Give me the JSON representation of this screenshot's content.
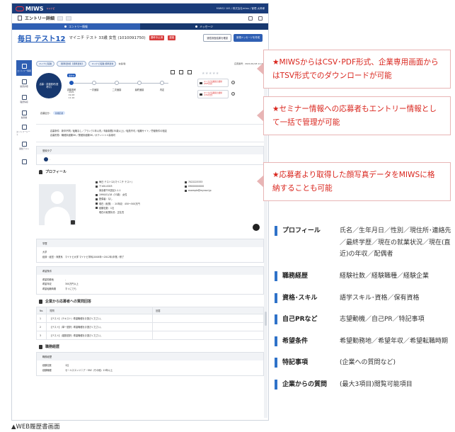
{
  "app": {
    "logo_text": "MIWS",
    "logo_sub": "マイナビ",
    "header_right": "MIWS2 10S / 株式会社miws / 管理 太郎様"
  },
  "titlebar": {
    "title": "エントリー詳細"
  },
  "tabs": [
    {
      "label": "エントリー情報",
      "active": true
    },
    {
      "label": "メッセージ",
      "active": false
    }
  ],
  "candidate": {
    "name": "毎日 テスト12",
    "kana_line": "マイニチ テスト 33歳 女性 (1010091750)",
    "badge1": "選考中止済",
    "badge2": "重複",
    "btn_assess": "適性検査結果を確認",
    "btn_message": "新規メッセージを作成"
  },
  "sidebar": [
    {
      "label": "エントリー情報",
      "active": true,
      "icon": "person-icon"
    },
    {
      "label": "履歴詳細",
      "active": false,
      "icon": "edit-icon"
    },
    {
      "label": "職歴情報",
      "active": false,
      "icon": "list-icon"
    },
    {
      "label": "履歴書",
      "active": false,
      "icon": "doc-icon"
    },
    {
      "label": "エントリーシート",
      "active": false,
      "icon": "person-icon"
    },
    {
      "label": "適性テスト",
      "active": false,
      "icon": "doc-icon"
    },
    {
      "label": "",
      "active": false,
      "icon": "share-icon"
    }
  ],
  "status": {
    "chip1": "マイナビ転職",
    "chip2": "【標準選考】【標準選考】",
    "chip3": "マイナビ転職 標準選考",
    "chip_label": "言語/職",
    "app_no": "応募番号：2021/01/18 11:47"
  },
  "progress": {
    "circle_text": "応募・書類選考(選考中)",
    "now_tag": "選考中",
    "steps": [
      {
        "label": "書類選考",
        "date": "2021\n01/18\n11:16",
        "done": true
      },
      {
        "label": "一次面接",
        "date": "",
        "done": false
      },
      {
        "label": "二次面接",
        "date": "",
        "done": false
      },
      {
        "label": "最終面接",
        "date": "",
        "done": false
      },
      {
        "label": "内定",
        "date": "",
        "done": false
      }
    ],
    "stars": "★★★★★",
    "dl1": "マイナビ転職提出書類\n(PDF形式)",
    "dl2": "マイナビ転職提出書類\n(CSV形式)",
    "help": "?",
    "apply_state_label": "応募区分：",
    "apply_state_value": "新規応募"
  },
  "routes": {
    "line1": "応募条件：新卒不問／転職なし／ブランク1年以内／年齢制限(35歳以上)／転勤不可／転職サイト／労働条件の相違",
    "line2": "応募形態：職種未経験OK／業種未経験OK／ポテンシャル採用可"
  },
  "tag_panel": {
    "title": "登録タグ",
    "value": "-"
  },
  "profile": {
    "title": "プロフィール",
    "name": "毎日 テスト12(マイニチ テスト)",
    "postal": "〒100-0003",
    "address": "東京都千代田区1-1-1",
    "birth": "1990/01/18（33歳） 女性",
    "marital": "配偶者：なし",
    "status": "現在（就業）：20年収：450〜500万円",
    "job_count": "経験社数：1社",
    "current": "現在の就業状況：正社員",
    "tel1": "7022223333",
    "tel2": "09000000000",
    "email": "example@mynavi.jp"
  },
  "education": {
    "title": "学歴",
    "line1": "大学",
    "line2": "経済・経営・商業系　マイナビ大学 マイナビ学科(2008年〜2012年)卒業／修了"
  },
  "wishes": {
    "title": "希望条件",
    "rows": [
      {
        "k": "希望勤務地",
        "v": "-"
      },
      {
        "k": "希望年収",
        "v": "300万円以上"
      },
      {
        "k": "希望転職時期",
        "v": "すぐにでも"
      }
    ]
  },
  "questions": {
    "title": "企業から応募者への質問回答",
    "headers": [
      "No.",
      "質問",
      "回答"
    ],
    "rows": [
      {
        "no": "1",
        "q": "【テスト】（テキスト）希望職種をお選びください。",
        "a": ""
      },
      {
        "no": "2",
        "q": "【テスト】（単一選択）希望職種をお選びください。",
        "a": ""
      },
      {
        "no": "3",
        "q": "【テスト】（複数選択）希望職種をお選びください。",
        "a": ""
      }
    ]
  },
  "career": {
    "title": "職務経歴",
    "sub": "職務経歴",
    "rows": [
      {
        "k": "経験社数",
        "v": "1社"
      },
      {
        "k": "経験職種",
        "v": "セールスエンジニア・FAE（その他）15年以上"
      }
    ]
  },
  "callouts": [
    "★MIWSからはCSV･PDF形式、企業専用画面からはTSV形式でのダウンロードが可能",
    "★セミナー情報への応募者もエントリー情報として一括で管理が可能",
    "★応募者より取得した顔写真データをMIWSに格納することも可能"
  ],
  "legend": [
    {
      "key": "プロフィール",
      "value": "氏名／生年月日／性別／現住所･連絡先／最終学歴／現在の就業状況／現在(直近)の年収／配偶者"
    },
    {
      "key": "職務経歴",
      "value": "経験社数／経験職種／経験企業"
    },
    {
      "key": "資格･スキル",
      "value": "語学スキル･資格／保有資格"
    },
    {
      "key": "自己PRなど",
      "value": "志望動機／自己PR／特記事項"
    },
    {
      "key": "希望条件",
      "value": "希望勤務地／希望年収／希望転職時期"
    },
    {
      "key": "特記事項",
      "value": "(企業への質問など)"
    },
    {
      "key": "企業からの質問",
      "value": "(最大3項目)閲覧可能項目"
    }
  ],
  "caption": "▲WEB履歴書画面"
}
